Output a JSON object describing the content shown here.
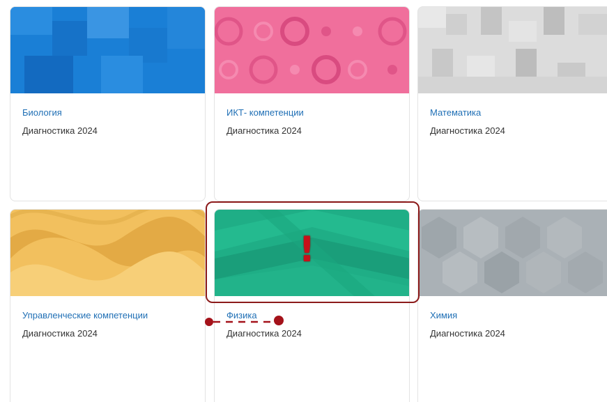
{
  "courses": [
    {
      "title": "Биология",
      "subtitle": "Диагностика 2024",
      "cover_color": "#1a7fd6"
    },
    {
      "title": "ИКТ- компетенции",
      "subtitle": "Диагностика 2024",
      "cover_color": "#f06f9c"
    },
    {
      "title": "Математика",
      "subtitle": "Диагностика 2024",
      "cover_color": "#d7d7d7"
    },
    {
      "title": "Управленческие компетенции",
      "subtitle": "Диагностика 2024",
      "cover_color": "#f2c05e"
    },
    {
      "title": "Физика",
      "subtitle": "Диагностика 2024",
      "cover_color": "#1fae86"
    },
    {
      "title": "Химия",
      "subtitle": "Диагностика 2024",
      "cover_color": "#aab1b6"
    }
  ],
  "annotation": {
    "mark": "!",
    "highlight_color": "#8c1a1a",
    "mark_color": "#c8101a"
  }
}
